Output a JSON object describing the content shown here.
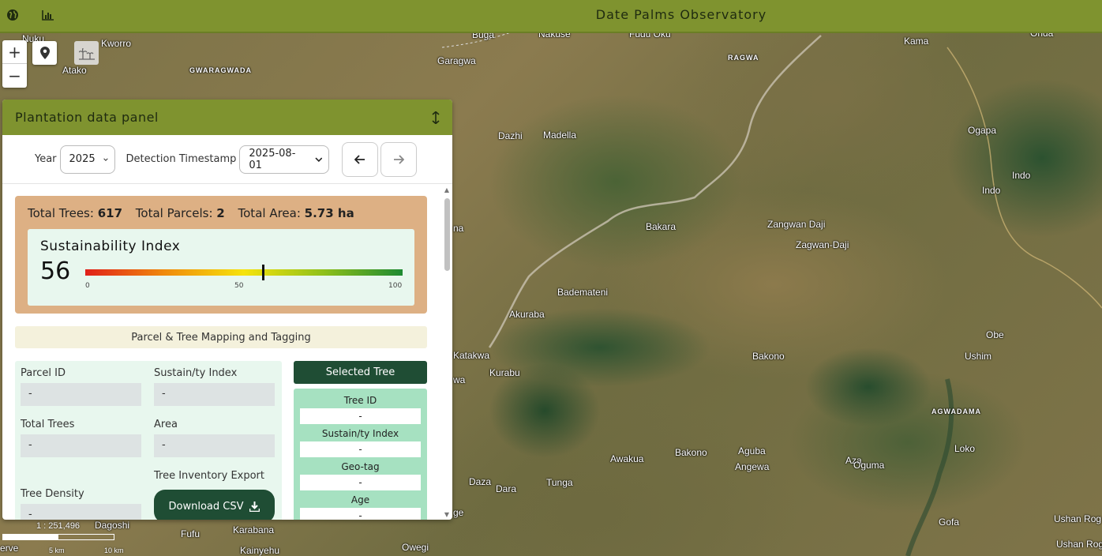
{
  "app": {
    "title": "Date Palms Observatory",
    "icons": [
      "globe-icon",
      "chart-icon"
    ],
    "colors": {
      "bar": "#7f932f",
      "dark_green": "#1f4d34"
    }
  },
  "map": {
    "zoom_in": "+",
    "zoom_out": "−",
    "scale_ratio": "1 : 251,496",
    "scale_labels": [
      "5 km",
      "10 km"
    ],
    "attribution": "erve",
    "places": [
      "Nuku",
      "Kworro",
      "Atako",
      "GWARAGWADA",
      "Buga",
      "Nakuse",
      "Fudu Oku",
      "Garagwa",
      "RAGWA",
      "Kama",
      "Onda",
      "Ogapa",
      "Indo",
      "Indo",
      "Dazhi",
      "Madella",
      "Bakara",
      "Zangwan Daji",
      "Zagwan-Daji",
      "na",
      "Bademateni",
      "Akuraba",
      "Katakwa",
      "Kurabu",
      "wa",
      "Obe",
      "Bakono",
      "Ushim",
      "AGWADAMA",
      "Loko",
      "Awakua",
      "Bakono",
      "Aguba",
      "Angewa",
      "Aza",
      "Oguma",
      "Daza",
      "Dara",
      "Tunga",
      "Gofa",
      "Dagoshi",
      "Fufu",
      "Karabana",
      "Kainyehu",
      "Owegi",
      "Ushan Rog",
      "Ushan Rog",
      "ge"
    ]
  },
  "panel": {
    "title": "Plantation data panel",
    "year_label": "Year",
    "year_value": "2025",
    "timestamp_label": "Detection Timestamp",
    "timestamp_value": "2025-08-01",
    "summary": {
      "total_trees_label": "Total Trees:",
      "total_trees": "617",
      "total_parcels_label": "Total Parcels:",
      "total_parcels": "2",
      "total_area_label": "Total Area:",
      "total_area": "5.73 ha"
    },
    "sustainability": {
      "title": "Sustainability Index",
      "value": "56",
      "index_fraction": 0.56,
      "min_label": "0",
      "mid_label": "50",
      "max_label": "100"
    },
    "mapping_title": "Parcel & Tree Mapping and Tagging",
    "parcel": {
      "parcel_id_label": "Parcel ID",
      "parcel_id": "-",
      "sustain_label": "Sustain/ty Index",
      "sustain": "-",
      "total_trees_label": "Total Trees",
      "total_trees": "-",
      "area_label": "Area",
      "area": "-",
      "tree_density_label": "Tree Density",
      "tree_density": "-",
      "export_label": "Tree Inventory Export",
      "download_label": "Download CSV"
    },
    "selected_tree": {
      "header": "Selected Tree",
      "tree_id_label": "Tree ID",
      "tree_id": "-",
      "sustain_label": "Sustain/ty Index",
      "sustain": "-",
      "geotag_label": "Geo-tag",
      "geotag": "-",
      "age_label": "Age",
      "age": "-"
    }
  }
}
